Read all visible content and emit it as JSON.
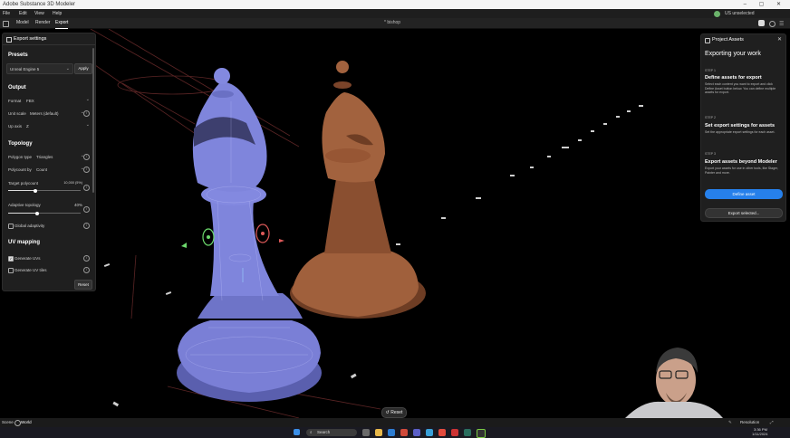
{
  "window": {
    "title": "Adobe Substance 3D Modeler"
  },
  "menu": {
    "items": [
      "File",
      "Edit",
      "View",
      "Help"
    ]
  },
  "mode_tabs": [
    {
      "label": "Model",
      "active": false
    },
    {
      "label": "Render",
      "active": false
    },
    {
      "label": "Export",
      "active": true
    }
  ],
  "doc_title": "* bishop",
  "top_right": {
    "status": "US unselected"
  },
  "export_settings": {
    "title": "Export settings",
    "presets": {
      "heading": "Presets",
      "value": "Unreal Engine 5",
      "apply": "Apply"
    },
    "output": {
      "heading": "Output",
      "format_label": "Format",
      "format_value": "FBX",
      "unit_label": "Unit scale",
      "unit_value": "Meters (default)",
      "upaxis_label": "Up axis",
      "upaxis_value": "Z"
    },
    "topology": {
      "heading": "Topology",
      "polytype_label": "Polygon type",
      "polytype_value": "Triangles",
      "polyby_label": "Polycount by",
      "polyby_value": "Count",
      "target_label": "Target polycount",
      "target_value": "10,000 (5%)",
      "target_level": 0.38,
      "adaptive_label": "Adaptive topology",
      "adaptive_value": "40%",
      "adaptive_level": 0.4,
      "global_label": "Global adaptivity",
      "global_checked": false
    },
    "uv": {
      "heading": "UV mapping",
      "gen_uvs_label": "Generate UVs",
      "gen_uvs_checked": true,
      "gen_tiles_label": "Generate UV tiles",
      "gen_tiles_checked": false
    },
    "reset": "Reset"
  },
  "project_assets": {
    "title": "Project Assets",
    "heading": "Exporting your work",
    "steps": [
      {
        "step": "STEP 1",
        "title": "Define assets for export",
        "desc": "Select each content you want to export and click Define Asset button below. You can define multiple assets for export."
      },
      {
        "step": "STEP 2",
        "title": "Set export settings for assets",
        "desc": "Set the appropriate export settings for each asset."
      },
      {
        "step": "STEP 3",
        "title": "Export assets beyond Modeler",
        "desc": "Export your assets for use in other tools, like Stager, Painter and more."
      }
    ],
    "define_button": "Define asset",
    "export_button": "Export selected..."
  },
  "viewport": {
    "reset_label": "Reset"
  },
  "statusbar": {
    "left": "Scene",
    "item": "World",
    "right": "Resolution"
  },
  "taskbar": {
    "search_placeholder": "Search",
    "time": "3:36 PM",
    "date": "1/11/2024"
  },
  "colors": {
    "accent_blue": "#2680eb",
    "bishop_blue": "#7a7fd6",
    "bishop_brown": "#9e5b3a",
    "wire_red": "#6b2a2a"
  }
}
